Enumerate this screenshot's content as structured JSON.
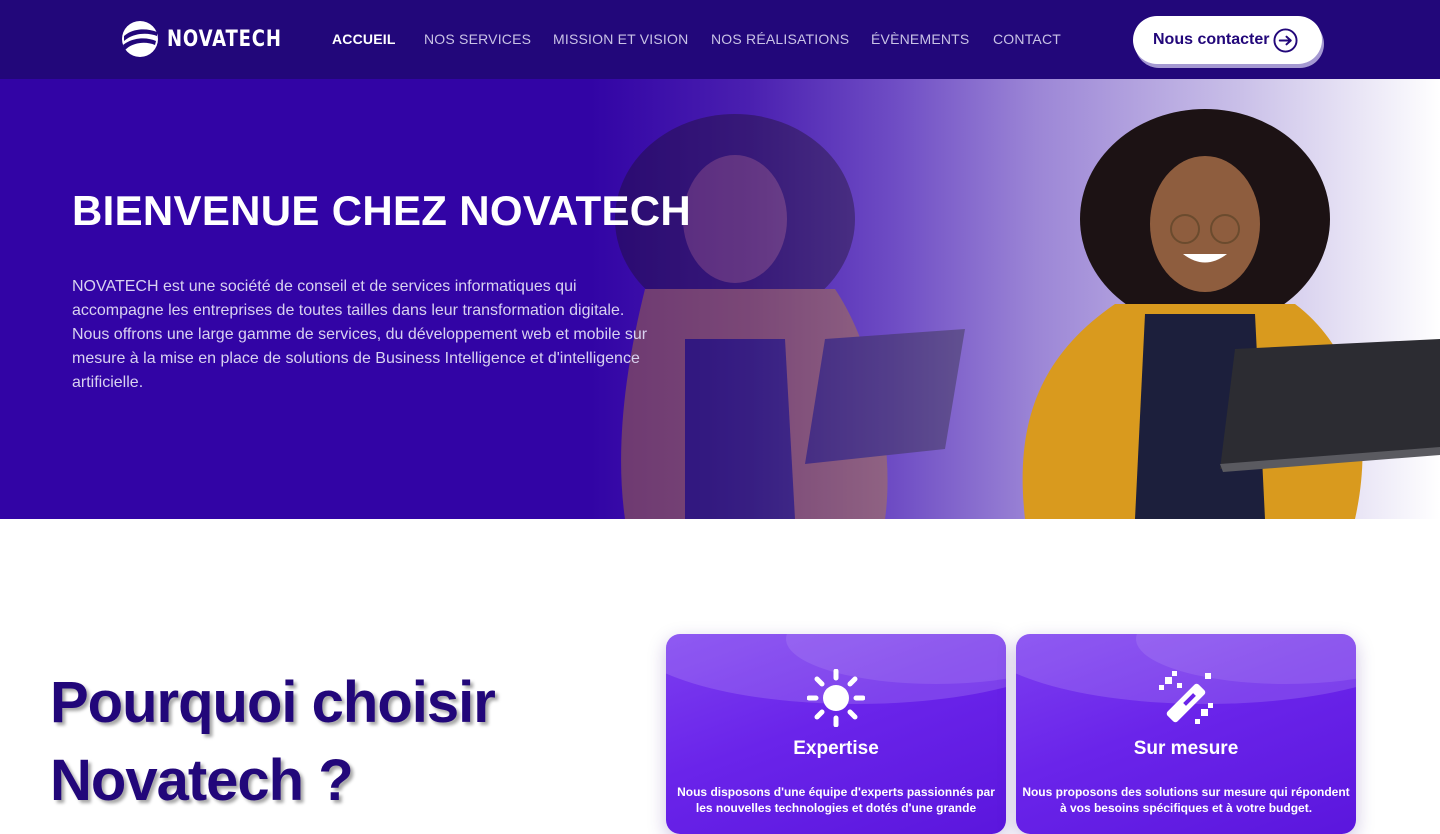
{
  "brand": {
    "name": "NOVATECH",
    "accent": "#22077a",
    "hero_bg": "#3204a5",
    "card_bg": "#6a24ea"
  },
  "nav": {
    "items": [
      {
        "label": "ACCUEIL",
        "active": true
      },
      {
        "label": "NOS SERVICES"
      },
      {
        "label": "MISSION ET VISION"
      },
      {
        "label": "NOS RÉALISATIONS"
      },
      {
        "label": "ÉVÈNEMENTS"
      },
      {
        "label": "CONTACT"
      }
    ],
    "cta_label": "Nous contacter",
    "cta_icon": "arrow-circle-right-icon"
  },
  "hero": {
    "title": "BIENVENUE CHEZ NOVATECH",
    "text": "NOVATECH est une société de conseil et de services informatiques qui accompagne les entreprises de toutes tailles dans leur transformation digitale. Nous offrons une large gamme de services, du développement web et mobile sur mesure à la mise en place de solutions de Business Intelligence et d'intelligence artificielle."
  },
  "why": {
    "title": "Pourquoi choisir Novatech ?",
    "cards": [
      {
        "icon": "sun-icon",
        "title": "Expertise",
        "text": "Nous disposons d'une équipe d'experts passionnés par les nouvelles technologies et dotés d'une grande"
      },
      {
        "icon": "magic-wand-icon",
        "title": "Sur mesure",
        "text": "Nous proposons des solutions sur mesure qui répondent à vos besoins spécifiques et à votre budget."
      }
    ]
  }
}
